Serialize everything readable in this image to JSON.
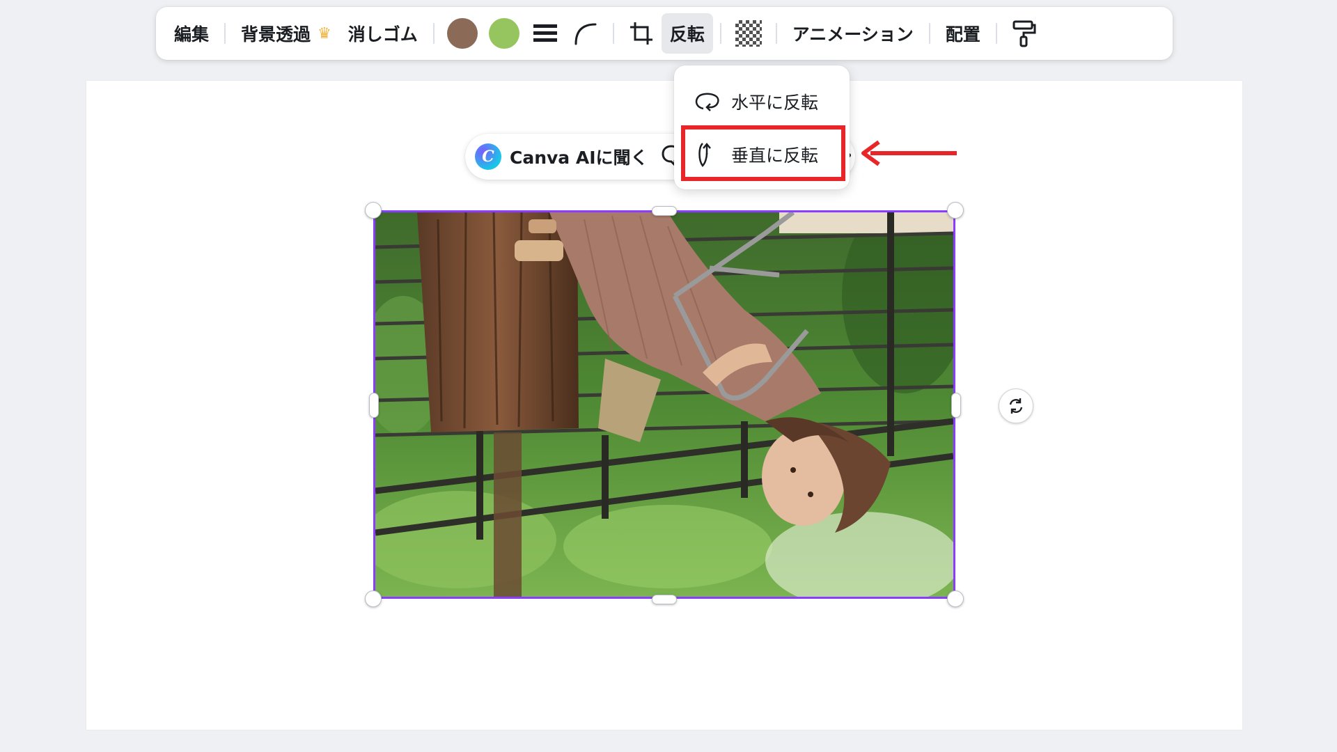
{
  "toolbar": {
    "edit_label": "編集",
    "bg_remove_label": "背景透過",
    "crown_icon": "crown-icon",
    "eraser_label": "消しゴム",
    "swatch_brown": "#8b6a58",
    "swatch_green": "#96c45e",
    "flip_label": "反転",
    "animation_label": "アニメーション",
    "arrange_label": "配置"
  },
  "ai_bar": {
    "label": "Canva AIに聞く",
    "logo_letter": "C"
  },
  "flip_menu": {
    "horizontal_label": "水平に反転",
    "vertical_label": "垂直に反転"
  },
  "colors": {
    "selection": "#8b3dff",
    "highlight": "#e8262a",
    "accent_arrow": "#e8262a"
  }
}
